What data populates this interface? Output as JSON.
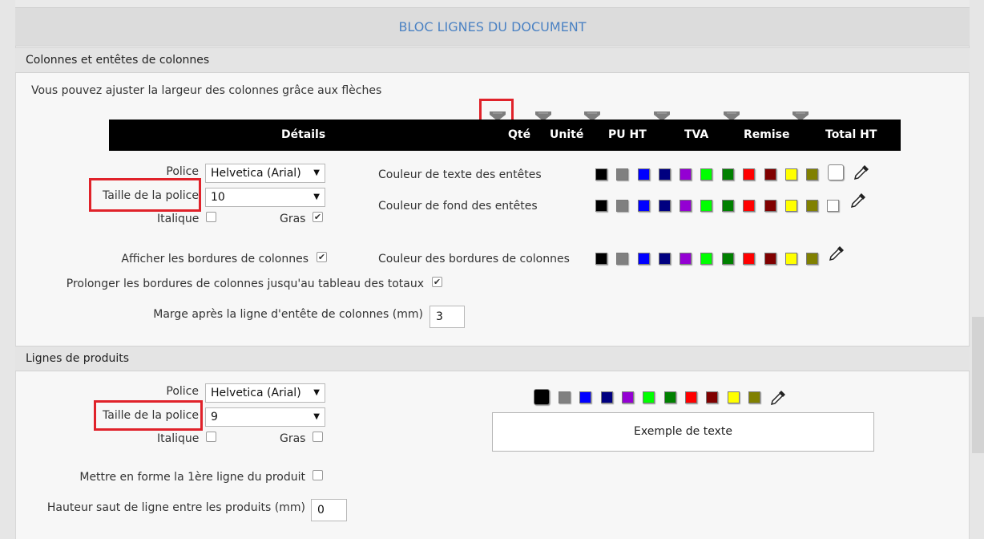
{
  "title": "BLOC LIGNES DU DOCUMENT",
  "section_columns": {
    "heading": "Colonnes et entêtes de colonnes",
    "hint": "Vous pouvez ajuster la largeur des colonnes grâce aux flèches",
    "columns": [
      "Détails",
      "Qté",
      "Unité",
      "PU HT",
      "TVA",
      "Remise",
      "Total HT"
    ],
    "font_label": "Police",
    "font_value": "Helvetica (Arial)",
    "size_label": "Taille de la police",
    "size_value": "10",
    "italic_label": "Italique",
    "bold_label": "Gras",
    "italic_checked": false,
    "bold_checked": true,
    "header_text_color_label": "Couleur de texte des entêtes",
    "header_bg_color_label": "Couleur de fond des entêtes",
    "show_borders_label": "Afficher les bordures de colonnes",
    "show_borders_checked": true,
    "border_color_label": "Couleur des bordures de colonnes",
    "extend_borders_label": "Prolonger les bordures de colonnes jusqu'au tableau des totaux",
    "extend_borders_checked": true,
    "margin_label": "Marge après la ligne d'entête de colonnes (mm)",
    "margin_value": "3"
  },
  "section_products": {
    "heading": "Lignes de produits",
    "font_label": "Police",
    "font_value": "Helvetica (Arial)",
    "size_label": "Taille de la police",
    "size_value": "9",
    "italic_label": "Italique",
    "bold_label": "Gras",
    "italic_checked": false,
    "bold_checked": false,
    "format_first_line_label": "Mettre en forme la 1ère ligne du produit",
    "format_first_line_checked": false,
    "line_spacing_label": "Hauteur saut de ligne entre les produits (mm)",
    "line_spacing_value": "0",
    "example_text": "Exemple de texte"
  },
  "palette": [
    "#000000",
    "#808080",
    "#0000ff",
    "#000080",
    "#9400d3",
    "#00ff00",
    "#008000",
    "#ff0000",
    "#800000",
    "#ffff00",
    "#808000"
  ],
  "colors": {
    "title": "#4b82c3",
    "header_bg": "#000000",
    "highlight": "#e0222a"
  },
  "icons": {
    "column_handle": "column-resize-handle-icon",
    "color_picker": "eyedropper-icon"
  }
}
